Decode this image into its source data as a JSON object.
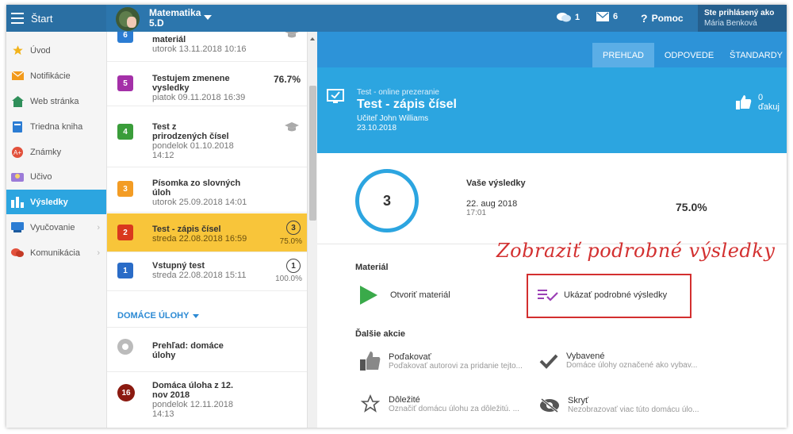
{
  "topbar": {
    "menu_label": "Štart",
    "course_name": "Matematika",
    "course_class": "5.D",
    "messages_count": "1",
    "mail_count": "6",
    "help_label": "Pomoc",
    "user_prefix": "Ste prihlásený ako",
    "user_name": "Mária Benková"
  },
  "sidebar": {
    "items": [
      {
        "label": "Úvod",
        "icon": "star-icon"
      },
      {
        "label": "Notifikácie",
        "icon": "envelope-icon"
      },
      {
        "label": "Web stránka",
        "icon": "house-icon"
      },
      {
        "label": "Triedna kniha",
        "icon": "book-icon"
      },
      {
        "label": "Známky",
        "icon": "grade-icon"
      },
      {
        "label": "Učivo",
        "icon": "folder-icon"
      },
      {
        "label": "Výsledky",
        "icon": "bar-chart-icon"
      },
      {
        "label": "Vyučovanie",
        "icon": "board-icon"
      },
      {
        "label": "Komunikácia",
        "icon": "chat-icon"
      }
    ]
  },
  "list": {
    "cards": [
      {
        "badge": "6",
        "title": "materiál",
        "date": "utorok 13.11.2018 10:16"
      },
      {
        "badge": "5",
        "title": "Testujem zmenene vysledky",
        "date": "piatok 09.11.2018 16:39",
        "score": "76.7%"
      },
      {
        "badge": "4",
        "title": "Test z prirodzených čísel",
        "date": "pondelok 01.10.2018 14:12"
      },
      {
        "badge": "3",
        "title": "Písomka zo slovných úloh",
        "date": "utorok 25.09.2018 14:01"
      },
      {
        "badge": "2",
        "title": "Test - zápis čísel",
        "date": "streda 22.08.2018 16:59",
        "attempts": "3",
        "percent": "75.0%"
      },
      {
        "badge": "1",
        "title": "Vstupný test",
        "date": "streda 22.08.2018 15:11",
        "attempts": "1",
        "percent": "100.0%"
      }
    ],
    "homework_header": "DOMÁCE ÚLOHY",
    "homework": [
      {
        "title": "Prehľad: domáce úlohy"
      },
      {
        "badge": "16",
        "title": "Domáca úloha z 12. nov 2018",
        "date": "pondelok 12.11.2018 14:13"
      }
    ]
  },
  "main": {
    "tabs": [
      {
        "label": "PREHĽAD"
      },
      {
        "label": "ODPOVEDE"
      },
      {
        "label": "ŠTANDARDY"
      }
    ],
    "test_kind": "Test - online prezeranie",
    "test_title": "Test - zápis čísel",
    "teacher": "Učiteľ John Williams",
    "date": "23.10.2018",
    "thanks_label": "0 ďakuj",
    "results_count": "3",
    "results_label": "Vaše výsledky",
    "results_date": "22. aug 2018",
    "results_time": "17:01",
    "results_percent": "75.0%",
    "annotation": "Zobraziť podrobné výsledky",
    "material_header": "Materiál",
    "open_material": "Otvoriť materiál",
    "show_details": "Ukázať podrobné výsledky",
    "other_header": "Ďalšie akcie",
    "actions": [
      {
        "title": "Poďakovať",
        "sub": "Poďakovať autorovi za pridanie tejto..."
      },
      {
        "title": "Vybavené",
        "sub": "Domáce úlohy označené ako vybav..."
      },
      {
        "title": "Dôležité",
        "sub": "Označiť domácu úlohu za dôležitú. ..."
      },
      {
        "title": "Skryť",
        "sub": "Nezobrazovať viac túto domácu úlo..."
      }
    ]
  },
  "colors": {
    "topbar": "#2c76ad",
    "accent": "#2ca5e0",
    "selected": "#f8c53a",
    "annotation": "#d33030",
    "badge_6": "#2b7cd3",
    "badge_5": "#a430a8",
    "badge_4": "#3a9d3a",
    "badge_3": "#f39c24",
    "badge_2": "#d9381e",
    "badge_1": "#2a6cc7",
    "badge_16": "#8b1a10"
  }
}
